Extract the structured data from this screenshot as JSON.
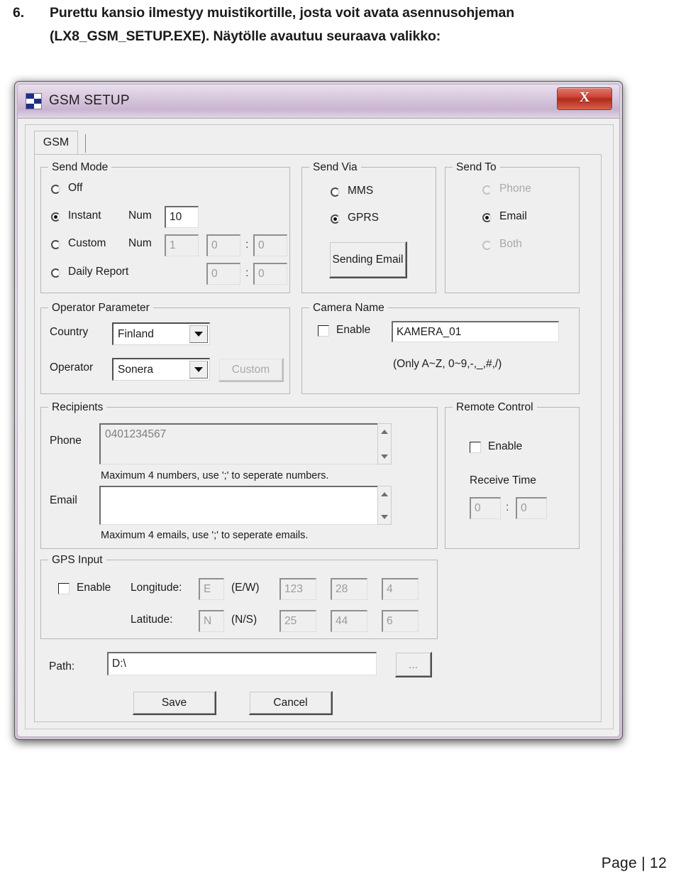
{
  "document": {
    "step_number": "6.",
    "line1": "Purettu kansio ilmestyy muistikortille, josta voit avata asennusohjeman",
    "line2": "(LX8_GSM_SETUP.EXE). Näytölle avautuu seuraava valikko:",
    "footer": "Page | 12"
  },
  "dialog": {
    "title": "GSM SETUP",
    "close_label": "X",
    "tab": {
      "label": "GSM"
    },
    "send_mode": {
      "title": "Send Mode",
      "off_label": "Off",
      "instant_label": "Instant",
      "custom_label": "Custom",
      "daily_label": "Daily Report",
      "num_label_1": "Num",
      "num_label_2": "Num",
      "instant_num": "10",
      "custom_num": "1",
      "custom_hour": "0",
      "custom_minute": "0",
      "daily_hour": "0",
      "daily_minute": "0",
      "colon": ":",
      "selected": "Instant"
    },
    "send_via": {
      "title": "Send Via",
      "mms_label": "MMS",
      "gprs_label": "GPRS",
      "selected": "GPRS",
      "sending_button": "Sending Email"
    },
    "send_to": {
      "title": "Send To",
      "phone_label": "Phone",
      "email_label": "Email",
      "both_label": "Both",
      "selected": "Email"
    },
    "operator_parameter": {
      "title": "Operator Parameter",
      "country_label": "Country",
      "country_value": "Finland",
      "operator_label": "Operator",
      "operator_value": "Sonera",
      "custom_button": "Custom"
    },
    "camera_name": {
      "title": "Camera Name",
      "enable_label": "Enable",
      "value": "KAMERA_01",
      "hint": "(Only A~Z, 0~9,-,_,#,/)"
    },
    "recipients": {
      "title": "Recipients",
      "phone_label": "Phone",
      "phone_value": "0401234567",
      "phone_hint": "Maximum 4 numbers, use ';' to  seperate  numbers.",
      "email_label": "Email",
      "email_value": "",
      "email_hint": "Maximum 4 emails, use ';' to seperate emails."
    },
    "remote_control": {
      "title": "Remote Control",
      "enable_label": "Enable",
      "receive_time_label": "Receive Time",
      "hour": "0",
      "minute": "0",
      "colon": ":"
    },
    "gps_input": {
      "title": "GPS Input",
      "enable_label": "Enable",
      "longitude_label": "Longitude:",
      "longitude_hemisphere": "E",
      "longitude_hint": "(E/W)",
      "longitude_deg": "123",
      "longitude_min": "28",
      "longitude_sec": "4",
      "latitude_label": "Latitude:",
      "latitude_hemisphere": "N",
      "latitude_hint": "(N/S)",
      "latitude_deg": "25",
      "latitude_min": "44",
      "latitude_sec": "6"
    },
    "path": {
      "label": "Path:",
      "value": "D:\\",
      "browse_label": "..."
    },
    "actions": {
      "save_label": "Save",
      "cancel_label": "Cancel"
    }
  }
}
